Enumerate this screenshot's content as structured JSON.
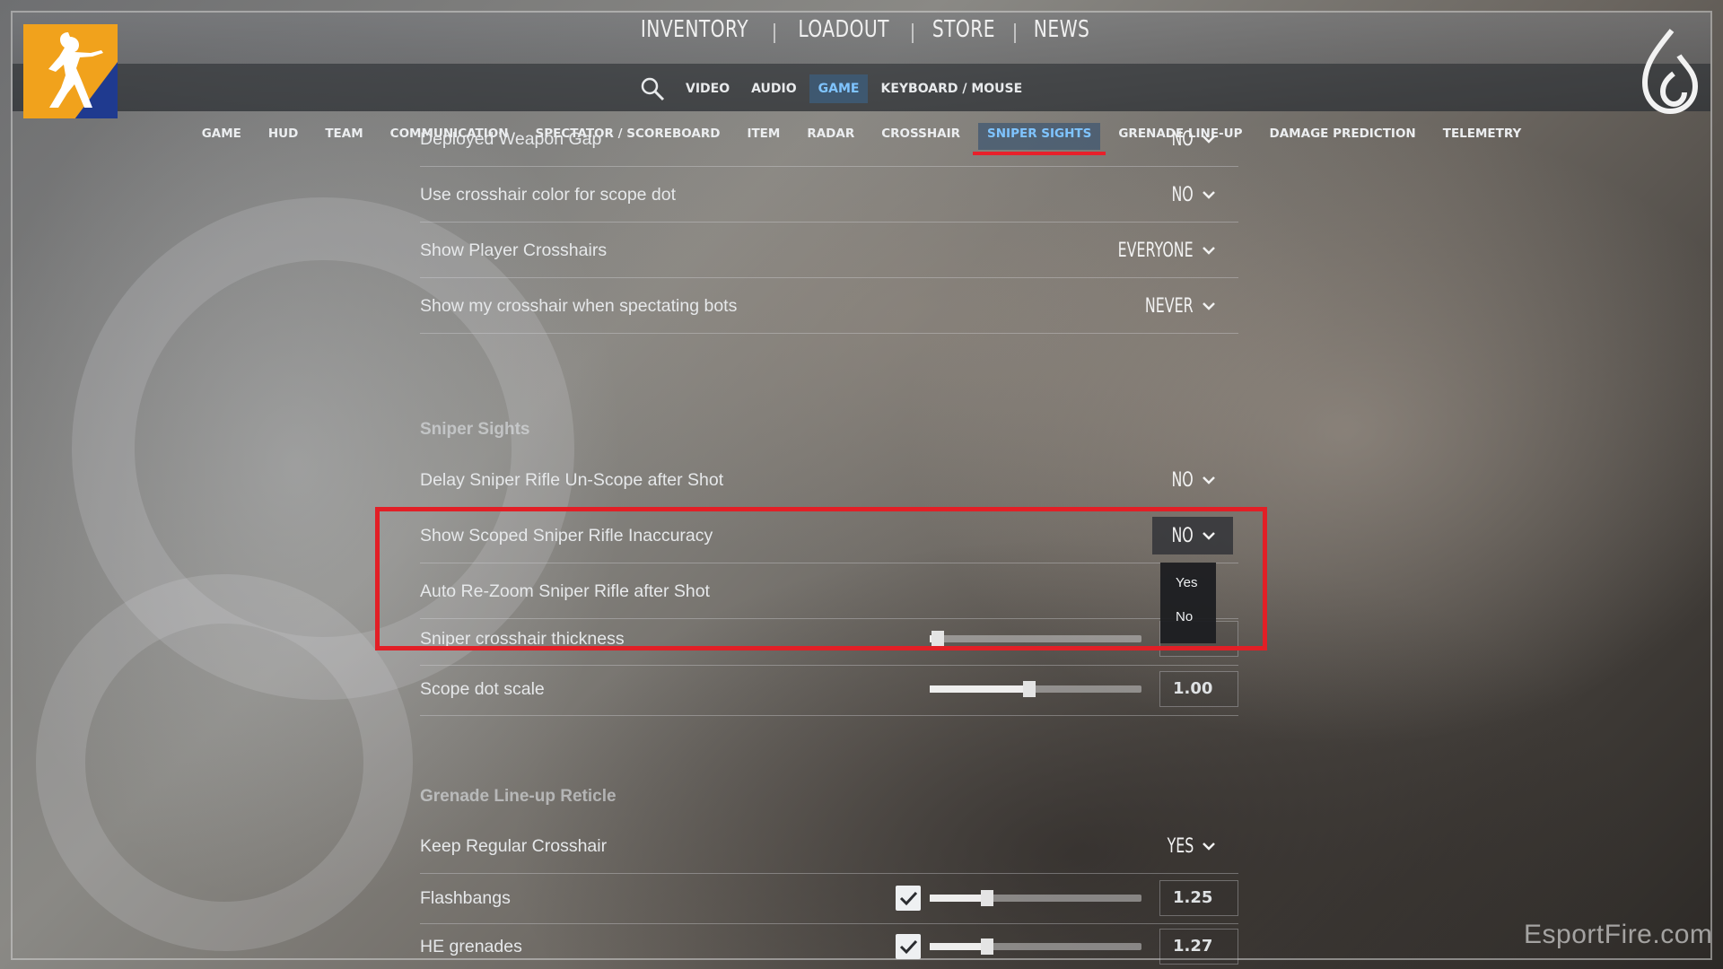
{
  "top_nav": [
    "INVENTORY",
    "LOADOUT",
    "STORE",
    "NEWS"
  ],
  "sub_nav": {
    "search_icon": "search-icon",
    "tabs": [
      {
        "label": "VIDEO"
      },
      {
        "label": "AUDIO"
      },
      {
        "label": "GAME",
        "active": true
      },
      {
        "label": "KEYBOARD / MOUSE"
      }
    ]
  },
  "category_nav": [
    {
      "label": "GAME"
    },
    {
      "label": "HUD"
    },
    {
      "label": "TEAM"
    },
    {
      "label": "COMMUNICATION"
    },
    {
      "label": "SPECTATOR / SCOREBOARD"
    },
    {
      "label": "ITEM"
    },
    {
      "label": "RADAR"
    },
    {
      "label": "CROSSHAIR"
    },
    {
      "label": "SNIPER SIGHTS",
      "active": true
    },
    {
      "label": "GRENADE LINE-UP"
    },
    {
      "label": "DAMAGE PREDICTION"
    },
    {
      "label": "TELEMETRY"
    }
  ],
  "settings_top": [
    {
      "label": "Deployed Weapon Gap",
      "value": "NO"
    },
    {
      "label": "Use crosshair color for scope dot",
      "value": "NO"
    },
    {
      "label": "Show Player Crosshairs",
      "value": "EVERYONE"
    },
    {
      "label": "Show my crosshair when spectating bots",
      "value": "NEVER"
    }
  ],
  "sniper_section": {
    "title": "Sniper Sights",
    "dropdowns": [
      {
        "label": "Delay Sniper Rifle Un-Scope after Shot",
        "value": "NO"
      },
      {
        "label": "Show Scoped Sniper Rifle Inaccuracy",
        "value": "NO",
        "open": true
      },
      {
        "label": "Auto Re-Zoom Sniper Rifle after Shot",
        "value": ""
      }
    ],
    "sliders": [
      {
        "label": "Sniper crosshair thickness",
        "value": "",
        "level": 0.04
      },
      {
        "label": "Scope dot scale",
        "value": "1.00",
        "level": 0.47
      }
    ]
  },
  "dropdown_popup": {
    "options": [
      "Yes",
      "No"
    ]
  },
  "grenade_section": {
    "title": "Grenade Line-up Reticle",
    "dropdown": {
      "label": "Keep Regular Crosshair",
      "value": "YES"
    },
    "sliders": [
      {
        "label": "Flashbangs",
        "value": "1.25",
        "checked": true,
        "level": 0.27
      },
      {
        "label": "HE grenades",
        "value": "1.27",
        "checked": true,
        "level": 0.27
      }
    ]
  },
  "watermark": "EsportFire.com",
  "colors": {
    "accent_blue": "#7fc4ff",
    "active_underline": "#e8202a",
    "highlight_box": "#e21f26",
    "logo_gold": "#f1a21c",
    "logo_blue": "#1f3a8f"
  },
  "icons": {
    "logo": "counter-strike-logo",
    "flame": "flame-icon",
    "chevron": "chevron-down-icon",
    "check": "check-icon"
  }
}
